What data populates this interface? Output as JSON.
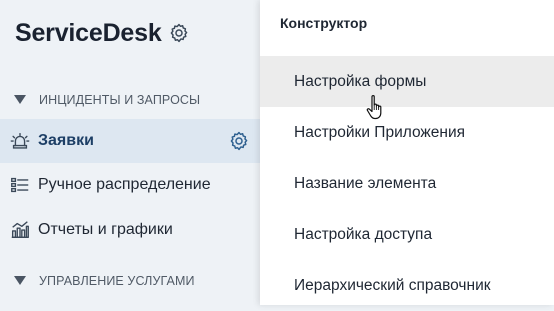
{
  "app": {
    "title": "ServiceDesk",
    "settings_icon": "gear-icon"
  },
  "sidebar": {
    "sections": [
      {
        "label": "ИНЦИДЕНТЫ И ЗАПРОСЫ",
        "expanded": true,
        "icon": "caret-down-icon"
      },
      {
        "label": "УПРАВЛЕНИЕ УСЛУГАМИ",
        "expanded": true,
        "icon": "caret-down-icon"
      }
    ],
    "items": [
      {
        "label": "Заявки",
        "icon": "alarm-bell-icon",
        "active": true,
        "settings_icon": "gear-icon"
      },
      {
        "label": "Ручное распределение",
        "icon": "list-distribution-icon",
        "active": false
      },
      {
        "label": "Отчеты и графики",
        "icon": "chart-icon",
        "active": false
      }
    ]
  },
  "dropdown": {
    "title": "Конструктор",
    "items": [
      {
        "label": "Настройка формы",
        "hovered": true
      },
      {
        "label": "Настройки Приложения",
        "hovered": false
      },
      {
        "label": "Название элемента",
        "hovered": false
      },
      {
        "label": "Настройка доступа",
        "hovered": false
      },
      {
        "label": "Иерархический справочник",
        "hovered": false
      }
    ]
  },
  "colors": {
    "sidebar_bg": "#eef2f6",
    "active_item_bg": "#dde7f1",
    "active_item_text": "#1d3f66",
    "menu_bg": "#ffffff",
    "menu_hover_bg": "#ececec",
    "icon_color": "#3a4858"
  },
  "cursor": {
    "icon": "hand-pointer-cursor"
  }
}
